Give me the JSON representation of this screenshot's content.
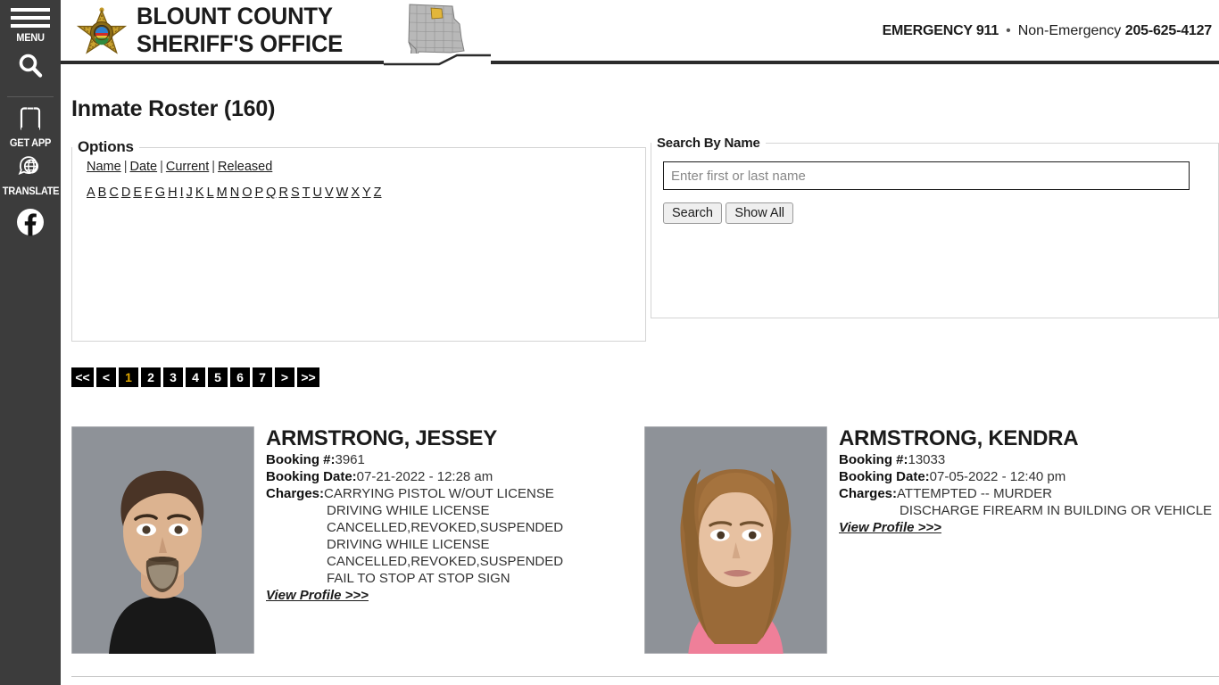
{
  "sidebar": {
    "menu_label": "MENU",
    "search_icon": "search-icon",
    "items": [
      {
        "icon": "phone-app-icon",
        "label": "GET APP"
      },
      {
        "icon": "globe-translate-icon",
        "label": "TRANSLATE"
      },
      {
        "icon": "facebook-icon",
        "label": ""
      }
    ]
  },
  "header": {
    "badge_icon": "sheriff-star-badge-icon",
    "org_line1": "BLOUNT COUNTY",
    "org_line2": "SHERIFF'S OFFICE",
    "map_icon": "alabama-state-map-icon",
    "map_label": "Alabama",
    "emergency_label": "EMERGENCY 911",
    "separator": "•",
    "nonemergency_label": "Non-Emergency",
    "nonemergency_number": "205-625-4127"
  },
  "main": {
    "page_title": "Inmate Roster (160)",
    "options": {
      "legend": "Options",
      "sort_links": [
        "Name",
        "Date",
        "Current",
        "Released"
      ],
      "separator": "|",
      "alphabet": [
        "A",
        "B",
        "C",
        "D",
        "E",
        "F",
        "G",
        "H",
        "I",
        "J",
        "K",
        "L",
        "M",
        "N",
        "O",
        "P",
        "Q",
        "R",
        "S",
        "T",
        "U",
        "V",
        "W",
        "X",
        "Y",
        "Z"
      ]
    },
    "search": {
      "legend": "Search By Name",
      "input_value": "",
      "placeholder": "Enter first or last name",
      "search_button": "Search",
      "showall_button": "Show All"
    },
    "pagination": {
      "first": "<<",
      "prev": "<",
      "pages": [
        "1",
        "2",
        "3",
        "4",
        "5",
        "6",
        "7"
      ],
      "active_page": "1",
      "next": ">",
      "last": ">>",
      "active_color": "#e0a800"
    },
    "labels": {
      "booking_number": "Booking #:",
      "booking_date": "Booking Date:",
      "charges": "Charges:",
      "view_profile": "View Profile >>>"
    },
    "inmates": [
      {
        "name": "ARMSTRONG, JESSEY",
        "booking_number": "3961",
        "booking_date": "07-21-2022 - 12:28 am",
        "charges": [
          "CARRYING PISTOL W/OUT LICENSE",
          "DRIVING WHILE LICENSE CANCELLED,REVOKED,SUSPENDED",
          "DRIVING WHILE LICENSE CANCELLED,REVOKED,SUSPENDED",
          "FAIL TO STOP AT STOP SIGN"
        ],
        "mugshot": "mugshot-armstrong-jessey"
      },
      {
        "name": "ARMSTRONG, KENDRA",
        "booking_number": "13033",
        "booking_date": "07-05-2022 - 12:40 pm",
        "charges": [
          "ATTEMPTED -- MURDER",
          "DISCHARGE FIREARM IN BUILDING OR VEHICLE"
        ],
        "mugshot": "mugshot-armstrong-kendra"
      }
    ]
  }
}
